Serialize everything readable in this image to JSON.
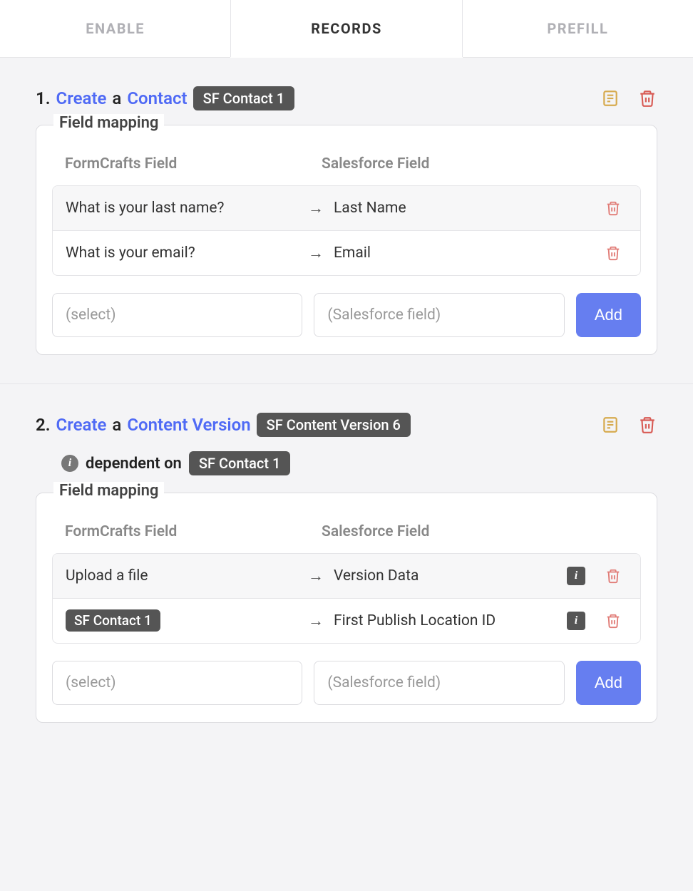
{
  "tabs": {
    "enable": "ENABLE",
    "records": "RECORDS",
    "prefill": "PREFILL"
  },
  "records": [
    {
      "number": "1.",
      "action": "Create",
      "a": "a",
      "object": "Contact",
      "badge": "SF Contact 1",
      "fieldset_label": "Field mapping",
      "col_fc": "FormCrafts Field",
      "col_sf": "Salesforce Field",
      "rows": [
        {
          "fc": "What is your last name?",
          "sf": "Last Name",
          "has_info": false
        },
        {
          "fc": "What is your email?",
          "sf": "Email",
          "has_info": false
        }
      ],
      "select_placeholder": "(select)",
      "sf_placeholder": "(Salesforce field)",
      "add_label": "Add"
    },
    {
      "number": "2.",
      "action": "Create",
      "a": "a",
      "object": "Content Version",
      "badge": "SF Content Version 6",
      "dependent_label": "dependent on",
      "dependent_badge": "SF Contact 1",
      "fieldset_label": "Field mapping",
      "col_fc": "FormCrafts Field",
      "col_sf": "Salesforce Field",
      "rows": [
        {
          "fc": "Upload a file",
          "sf": "Version Data",
          "has_info": true
        },
        {
          "fc_badge": "SF Contact 1",
          "sf": "First Publish Location ID",
          "has_info": true
        }
      ],
      "select_placeholder": "(select)",
      "sf_placeholder": "(Salesforce field)",
      "add_label": "Add"
    }
  ]
}
